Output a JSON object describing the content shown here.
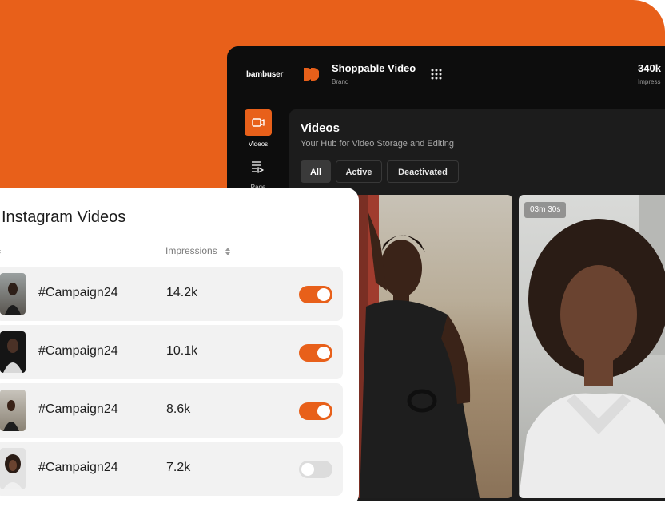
{
  "colors": {
    "accent": "#e8601a",
    "dashboard_bg": "#0d0d0d",
    "panel_bg": "#1c1c1c"
  },
  "dashboard": {
    "logo": "bambuser",
    "brand": {
      "title": "Shoppable Video",
      "subtitle": "Brand",
      "icon": "double-play-icon"
    },
    "apps_icon": "grid-icon",
    "stat": {
      "value": "340k",
      "label": "Impress"
    },
    "nav": [
      {
        "label": "Videos",
        "icon": "video-camera-icon",
        "active": true
      },
      {
        "label": "Page",
        "icon": "page-list-icon",
        "active": false
      }
    ],
    "content": {
      "title": "Videos",
      "subtitle": "Your Hub for Video Storage and Editing",
      "filters": [
        "All",
        "Active",
        "Deactivated"
      ],
      "active_filter": "All"
    },
    "video_cards": [
      {
        "duration": ""
      },
      {
        "duration": "03m 30s"
      }
    ]
  },
  "instagram": {
    "title": "Instagram Videos",
    "columns": {
      "impressions": "Impressions"
    },
    "rows": [
      {
        "name": "#Campaign24",
        "impressions": "14.2k",
        "enabled": true
      },
      {
        "name": "#Campaign24",
        "impressions": "10.1k",
        "enabled": true
      },
      {
        "name": "#Campaign24",
        "impressions": "8.6k",
        "enabled": true
      },
      {
        "name": "#Campaign24",
        "impressions": "7.2k",
        "enabled": false
      }
    ]
  }
}
